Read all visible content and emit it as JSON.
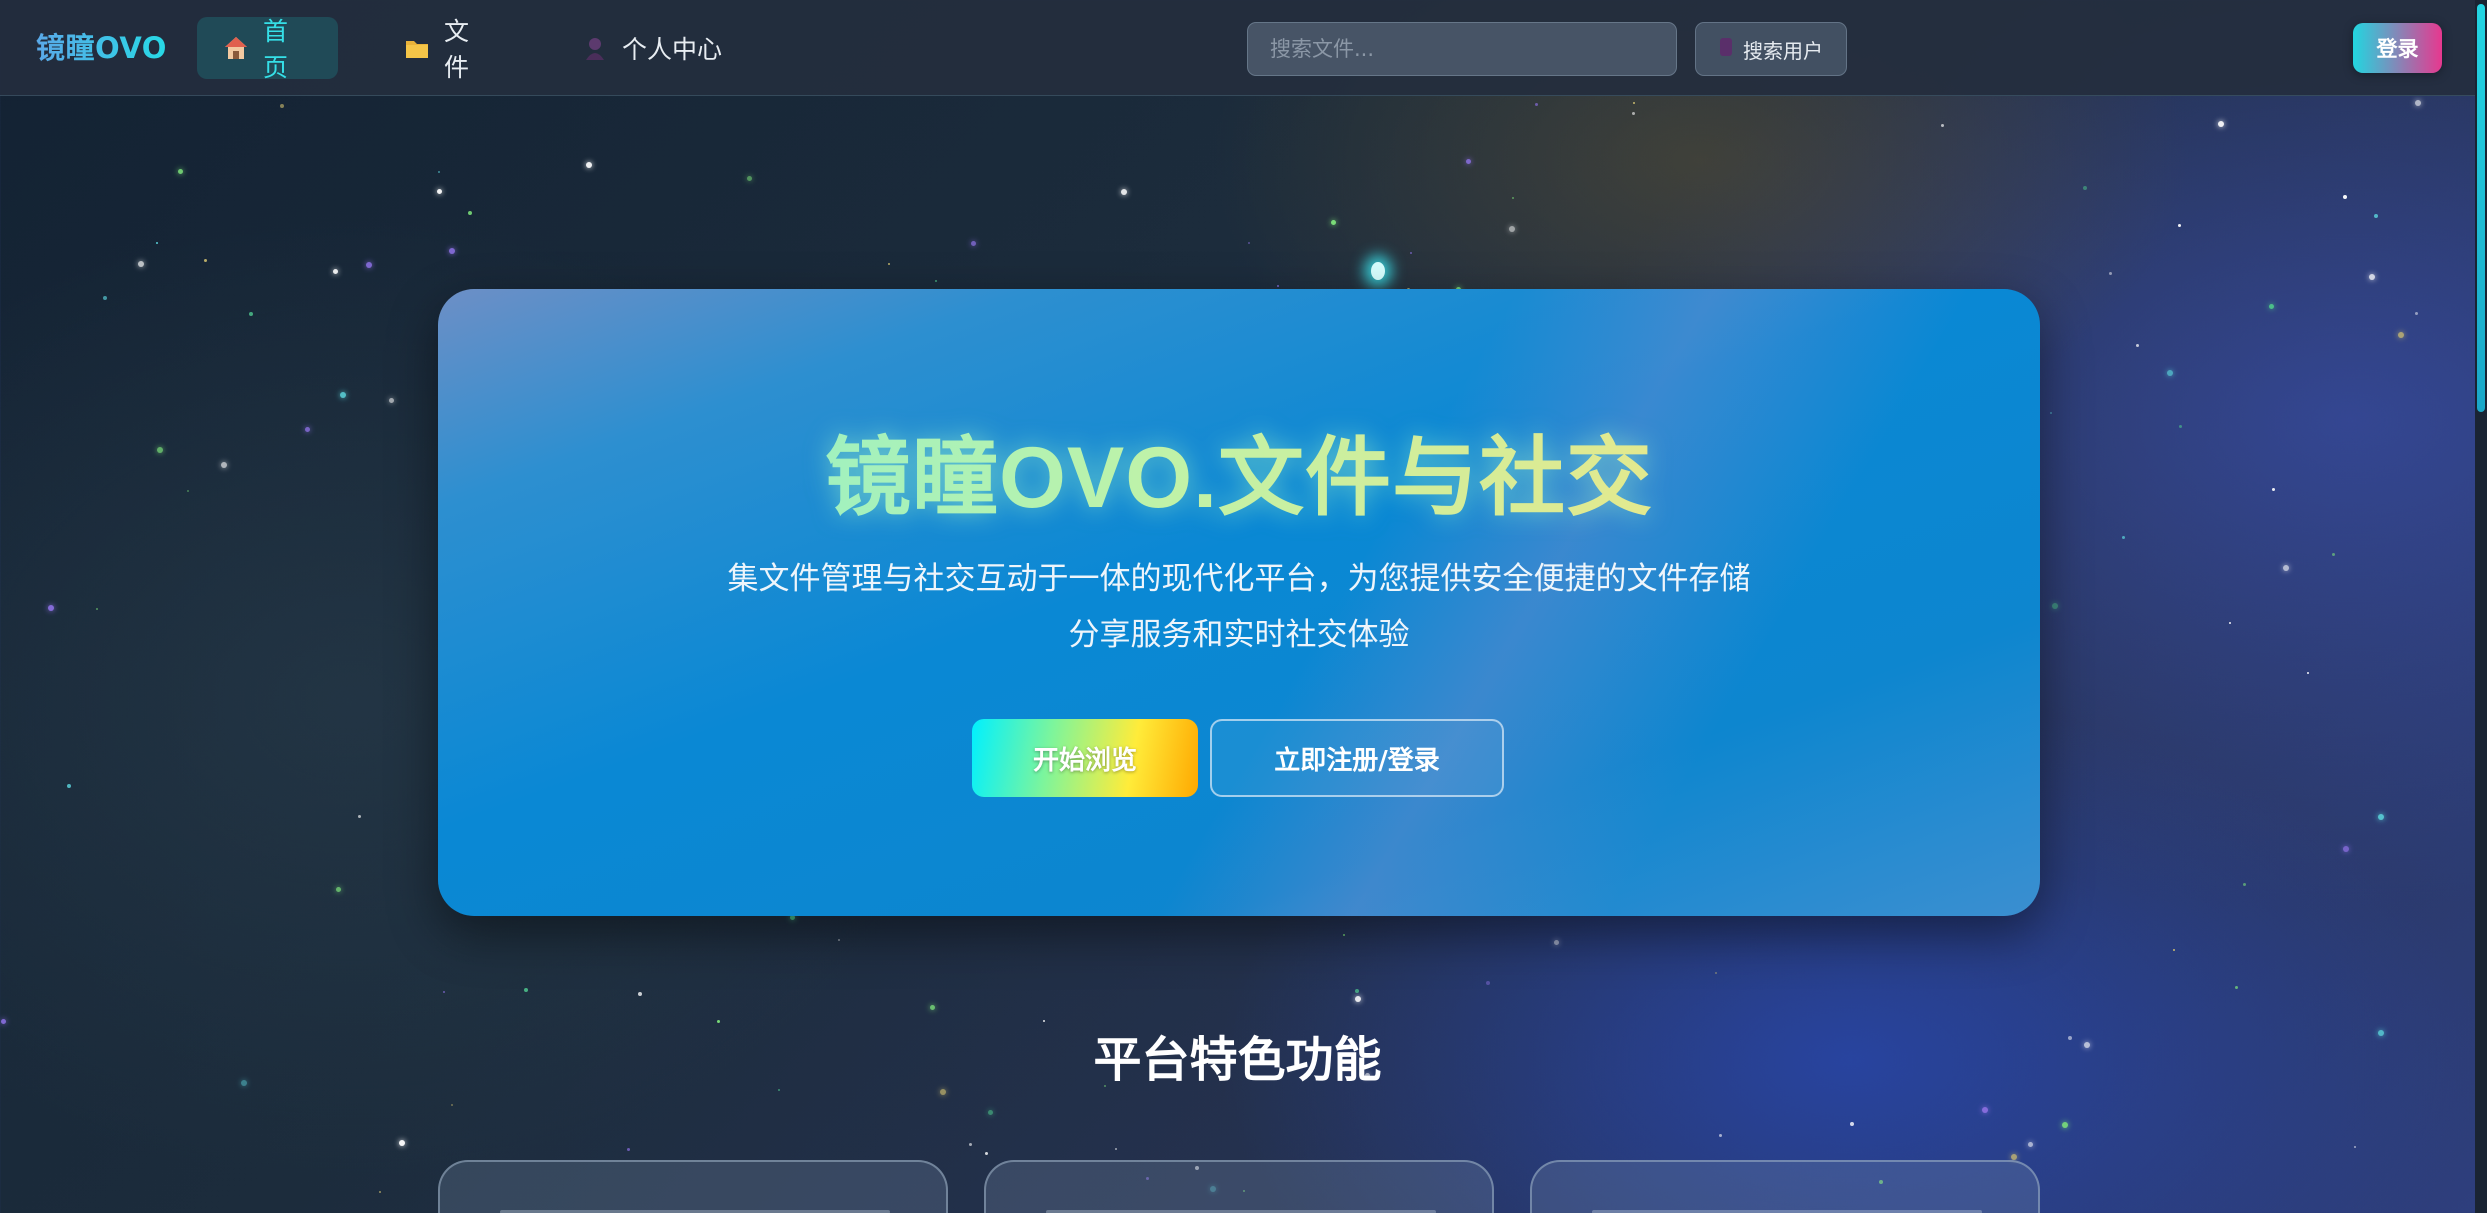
{
  "header": {
    "brand": "镜瞳OVO",
    "nav": [
      {
        "label": "首页",
        "icon": "home-icon",
        "active": true
      },
      {
        "label": "文件",
        "icon": "folder-icon",
        "active": false
      },
      {
        "label": "个人中心",
        "icon": "user-icon",
        "active": false
      }
    ],
    "search": {
      "placeholder": "搜索文件...",
      "value": ""
    },
    "search_user_label": "搜索用户",
    "search_user_icon": "user-silhouette-icon",
    "login_label": "登录"
  },
  "hero": {
    "title": "镜瞳OVO.文件与社交",
    "subtitle_line1": "集文件管理与社交互动于一体的现代化平台，为您提供安全便捷的文件存储",
    "subtitle_line2": "分享服务和实时社交体验",
    "primary_button": "开始浏览",
    "secondary_button": "立即注册/登录"
  },
  "features": {
    "title": "平台特色功能"
  },
  "colors": {
    "accent": "#27d9e6",
    "login_gradient_start": "#22d6e0",
    "login_gradient_end": "#e7388f",
    "hero_blue": "#0a88d4"
  }
}
